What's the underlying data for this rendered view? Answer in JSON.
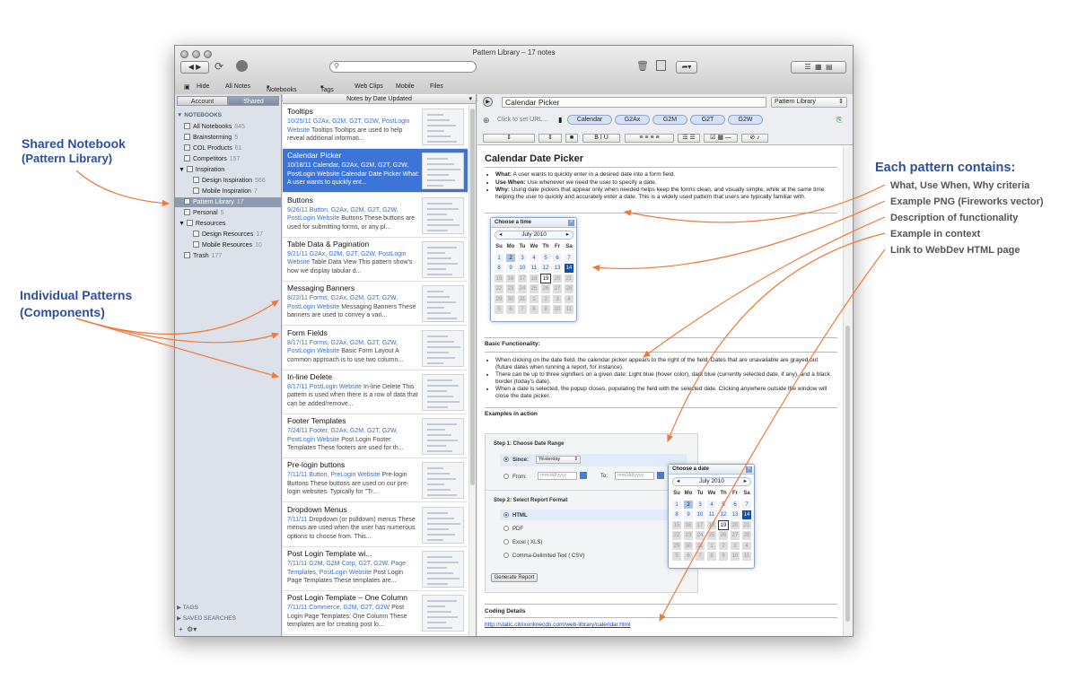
{
  "annotations": {
    "shared_title": "Shared Notebook",
    "shared_sub": "(Pattern Library)",
    "patterns_title": "Individual Patterns",
    "patterns_sub": "(Components)",
    "contains_title": "Each pattern contains:",
    "callouts": [
      "What, Use When, Why criteria",
      "Example PNG (Fireworks vector)",
      "Description of functionality",
      "Example in context",
      "Link to WebDev HTML page"
    ]
  },
  "window": {
    "title": "Pattern Library – 17 notes",
    "toolbar": {
      "hide": "Hide",
      "all_notes": "All Notes",
      "notebooks": "Notebooks",
      "tags": "Tags",
      "web_clips": "Web Clips",
      "mobile": "Mobile",
      "files": "Files"
    }
  },
  "sidebar": {
    "tab_account": "Account",
    "tab_shared": "Shared",
    "notebooks_header": "NOTEBOOKS",
    "items": [
      {
        "label": "All Notebooks",
        "count": "845"
      },
      {
        "label": "Brainstorming",
        "count": "5"
      },
      {
        "label": "COL Products",
        "count": "61"
      },
      {
        "label": "Competitors",
        "count": "157"
      },
      {
        "label": "Inspiration",
        "count": ""
      },
      {
        "label": "Design Inspiration",
        "count": "566"
      },
      {
        "label": "Mobile Inspiration",
        "count": "7"
      },
      {
        "label": "Pattern Library",
        "count": "17"
      },
      {
        "label": "Personal",
        "count": "5"
      },
      {
        "label": "Resources",
        "count": ""
      },
      {
        "label": "Design Resources",
        "count": "17"
      },
      {
        "label": "Mobile Resources",
        "count": "10"
      },
      {
        "label": "Trash",
        "count": "177"
      }
    ],
    "tags_header": "TAGS",
    "saved_header": "SAVED SEARCHES"
  },
  "notes_list": {
    "header": "Notes by Date Updated",
    "notes": [
      {
        "title": "Tooltips",
        "date": "10/25/11",
        "tags": "G2Ax, G2M, G2T, G2W, PostLogin Website",
        "snippet": "Tooltips Tooltips are used to help reveal additional informati..."
      },
      {
        "title": "Calendar Picker",
        "date": "10/18/11",
        "tags": "Calendar, G2Ax, G2M, G2T, G2W, PostLogin Website",
        "snippet": "Calendar Date Picker What: A user wants to quickly ent..."
      },
      {
        "title": "Buttons",
        "date": "9/26/11",
        "tags": "Button, G2Ax, G2M, G2T, G2W, PostLogin Website",
        "snippet": "Buttons These buttons are used for submitting forms, or any pl..."
      },
      {
        "title": "Table Data & Pagination",
        "date": "9/21/11",
        "tags": "G2Ax, G2M, G2T, G2W, PostLogin Website",
        "snippet": "Table Data View This pattern show's how we display tabular d..."
      },
      {
        "title": "Messaging Banners",
        "date": "8/22/11",
        "tags": "Forms, G2Ax, G2M, G2T, G2W, PostLogin Website",
        "snippet": "Messaging Banners These banners are used to convey a vari..."
      },
      {
        "title": "Form Fields",
        "date": "8/17/11",
        "tags": "Forms, G2Ax, G2M, G2T, G2W, PostLogin Website",
        "snippet": "Basic Form Layout A common approach is to use two column..."
      },
      {
        "title": "In-line Delete",
        "date": "8/17/11",
        "tags": "PostLogin Website",
        "snippet": "In-line Delete This pattern is used when there is a row of data that can be added/remove..."
      },
      {
        "title": "Footer Templates",
        "date": "7/24/11",
        "tags": "Footer, G2Ax, G2M, G2T, G2W, PostLogin Website",
        "snippet": "Post Login Footer Templates These footers are used for th..."
      },
      {
        "title": "Pre-login buttons",
        "date": "7/11/11",
        "tags": "Button, PreLogin Website",
        "snippet": "Pre-login Buttons These buttons are used on our pre-login websites. Typically for \"Tr..."
      },
      {
        "title": "Dropdown Menus",
        "date": "7/11/11",
        "tags": "",
        "snippet": "Dropdown (or pulldown) menus These menus are used when the user has numerous options to choose from. This..."
      },
      {
        "title": "Post Login Template wi...",
        "date": "7/11/11",
        "tags": "G2M, G2M Corp, G2T, G2W, Page Templates, PostLogin Website",
        "snippet": "Post Login Page Templates These templates are..."
      },
      {
        "title": "Post Login Template – One Column",
        "date": "7/11/11",
        "tags": "Commerce, G2M, G2T, G2W",
        "snippet": "Post Login Page Templates: One Column These templates are for creating post lo..."
      }
    ]
  },
  "editor": {
    "title_value": "Calendar Picker",
    "notebook_select": "Pattern Library",
    "url_placeholder": "Click to set URL...",
    "tags": [
      "Calendar",
      "G2Ax",
      "G2M",
      "G2T",
      "G2W"
    ],
    "doc": {
      "heading": "Calendar Date Picker",
      "criteria": [
        {
          "key": "What:",
          "text": "A user wants to quickly enter in a desired date into a form field."
        },
        {
          "key": "Use When:",
          "text": "Use whenever we need the user to specify a date."
        },
        {
          "key": "Why:",
          "text": "Using date pickers that appear only when needed helps keep the forms clean, and visually simple, while at the same time helping the user to quickly and accurately enter a date. This is a widely used pattern that users are typically familiar with."
        }
      ],
      "calendar1": {
        "title": "Choose a time",
        "month": "July 2010"
      },
      "basic_heading": "Basic Functionality:",
      "basic": [
        "When clicking on the date field, the calendar picker appears to the right of the field. Dates that are unavailable are grayed out (future dates when running a report, for instance).",
        "There can be up to three signifiers on a given date: Light blue (hover color), dark blue (currently selected date, if any), and a black border (today's date).",
        "When a date is selected, the popup closes, populating the field with the selected date. Clicking anywhere outside the window will close the date picker."
      ],
      "examples_heading": "Examples in action",
      "form": {
        "step1": "Step 1: Choose Date Range",
        "since": "Since:",
        "since_value": "Yesterday",
        "from": "From:",
        "to": "To:",
        "date_placeholder": "mm/dd/yyyy",
        "step2": "Step 2: Select Report Format",
        "formats": [
          "HTML",
          "PDF",
          "Excel ( XLS)",
          "Comma-Delimited Text ( CSV)"
        ],
        "generate": "Generate Report"
      },
      "calendar2": {
        "title": "Choose a date",
        "month": "July 2010"
      },
      "weekdays": [
        "Su",
        "Mo",
        "Tu",
        "We",
        "Th",
        "Fr",
        "Sa"
      ],
      "coding_heading": "Coding Details",
      "link": "http://static.citrixonlinecdn.com/web-library/calendar.html"
    }
  }
}
